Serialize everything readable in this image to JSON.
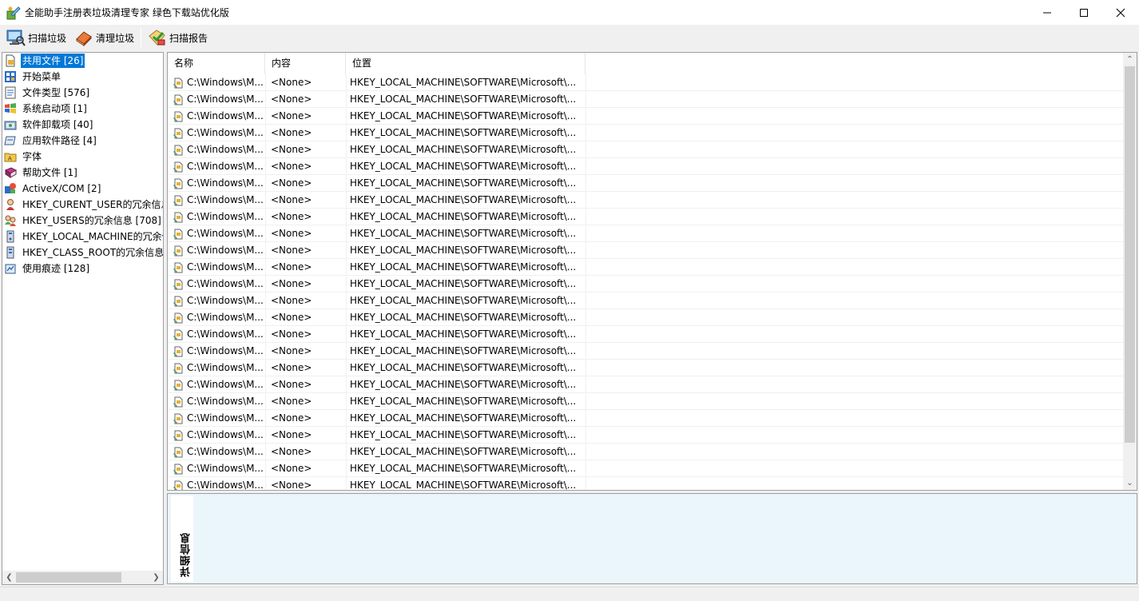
{
  "window": {
    "title": "全能助手注册表垃圾清理专家 绿色下载站优化版",
    "controls": [
      "minimize",
      "maximize",
      "close"
    ]
  },
  "toolbar": {
    "buttons": [
      {
        "label": "扫描垃圾",
        "icon": "scan-computer-icon"
      },
      {
        "label": "清理垃圾",
        "icon": "eraser-icon"
      },
      {
        "label": "扫描报告",
        "icon": "report-check-icon"
      }
    ]
  },
  "tree": {
    "items": [
      {
        "label": "共用文件 [26]",
        "icon": "shared-file-icon",
        "selected": true
      },
      {
        "label": "开始菜单",
        "icon": "start-menu-icon"
      },
      {
        "label": "文件类型 [576]",
        "icon": "file-type-icon"
      },
      {
        "label": "系统启动项 [1]",
        "icon": "windows-flag-icon"
      },
      {
        "label": "软件卸载项 [40]",
        "icon": "uninstall-icon"
      },
      {
        "label": "应用软件路径 [4]",
        "icon": "app-path-icon"
      },
      {
        "label": "字体",
        "icon": "font-folder-icon"
      },
      {
        "label": "帮助文件 [1]",
        "icon": "help-book-icon"
      },
      {
        "label": "ActiveX/COM [2]",
        "icon": "activex-icon"
      },
      {
        "label": "HKEY_CURENT_USER的冗余信息",
        "icon": "user-icon"
      },
      {
        "label": "HKEY_USERS的冗余信息 [708]",
        "icon": "users-icon"
      },
      {
        "label": "HKEY_LOCAL_MACHINE的冗余信息",
        "icon": "machine-icon"
      },
      {
        "label": "HKEY_CLASS_ROOT的冗余信息",
        "icon": "class-root-icon"
      },
      {
        "label": "使用痕迹 [128]",
        "icon": "trace-icon"
      }
    ]
  },
  "list": {
    "columns": [
      "名称",
      "内容",
      "位置"
    ],
    "rows": [
      [
        "C:\\Windows\\M...",
        "<None>",
        "HKEY_LOCAL_MACHINE\\SOFTWARE\\Microsoft\\..."
      ],
      [
        "C:\\Windows\\M...",
        "<None>",
        "HKEY_LOCAL_MACHINE\\SOFTWARE\\Microsoft\\..."
      ],
      [
        "C:\\Windows\\M...",
        "<None>",
        "HKEY_LOCAL_MACHINE\\SOFTWARE\\Microsoft\\..."
      ],
      [
        "C:\\Windows\\M...",
        "<None>",
        "HKEY_LOCAL_MACHINE\\SOFTWARE\\Microsoft\\..."
      ],
      [
        "C:\\Windows\\M...",
        "<None>",
        "HKEY_LOCAL_MACHINE\\SOFTWARE\\Microsoft\\..."
      ],
      [
        "C:\\Windows\\M...",
        "<None>",
        "HKEY_LOCAL_MACHINE\\SOFTWARE\\Microsoft\\..."
      ],
      [
        "C:\\Windows\\M...",
        "<None>",
        "HKEY_LOCAL_MACHINE\\SOFTWARE\\Microsoft\\..."
      ],
      [
        "C:\\Windows\\M...",
        "<None>",
        "HKEY_LOCAL_MACHINE\\SOFTWARE\\Microsoft\\..."
      ],
      [
        "C:\\Windows\\M...",
        "<None>",
        "HKEY_LOCAL_MACHINE\\SOFTWARE\\Microsoft\\..."
      ],
      [
        "C:\\Windows\\M...",
        "<None>",
        "HKEY_LOCAL_MACHINE\\SOFTWARE\\Microsoft\\..."
      ],
      [
        "C:\\Windows\\M...",
        "<None>",
        "HKEY_LOCAL_MACHINE\\SOFTWARE\\Microsoft\\..."
      ],
      [
        "C:\\Windows\\M...",
        "<None>",
        "HKEY_LOCAL_MACHINE\\SOFTWARE\\Microsoft\\..."
      ],
      [
        "C:\\Windows\\M...",
        "<None>",
        "HKEY_LOCAL_MACHINE\\SOFTWARE\\Microsoft\\..."
      ],
      [
        "C:\\Windows\\M...",
        "<None>",
        "HKEY_LOCAL_MACHINE\\SOFTWARE\\Microsoft\\..."
      ],
      [
        "C:\\Windows\\M...",
        "<None>",
        "HKEY_LOCAL_MACHINE\\SOFTWARE\\Microsoft\\..."
      ],
      [
        "C:\\Windows\\M...",
        "<None>",
        "HKEY_LOCAL_MACHINE\\SOFTWARE\\Microsoft\\..."
      ],
      [
        "C:\\Windows\\M...",
        "<None>",
        "HKEY_LOCAL_MACHINE\\SOFTWARE\\Microsoft\\..."
      ],
      [
        "C:\\Windows\\M...",
        "<None>",
        "HKEY_LOCAL_MACHINE\\SOFTWARE\\Microsoft\\..."
      ],
      [
        "C:\\Windows\\M...",
        "<None>",
        "HKEY_LOCAL_MACHINE\\SOFTWARE\\Microsoft\\..."
      ],
      [
        "C:\\Windows\\M...",
        "<None>",
        "HKEY_LOCAL_MACHINE\\SOFTWARE\\Microsoft\\..."
      ],
      [
        "C:\\Windows\\M...",
        "<None>",
        "HKEY_LOCAL_MACHINE\\SOFTWARE\\Microsoft\\..."
      ],
      [
        "C:\\Windows\\M...",
        "<None>",
        "HKEY_LOCAL_MACHINE\\SOFTWARE\\Microsoft\\..."
      ],
      [
        "C:\\Windows\\M...",
        "<None>",
        "HKEY_LOCAL_MACHINE\\SOFTWARE\\Microsoft\\..."
      ],
      [
        "C:\\Windows\\M...",
        "<None>",
        "HKEY_LOCAL_MACHINE\\SOFTWARE\\Microsoft\\..."
      ],
      [
        "C:\\Windows\\M...",
        "<None>",
        "HKEY_LOCAL_MACHINE\\SOFTWARE\\Microsoft\\..."
      ]
    ]
  },
  "detail": {
    "label": "详细信息"
  },
  "colors": {
    "selection": "#0078d7",
    "detail_bg": "#eaf5fc",
    "window_bg": "#f0f0f0"
  }
}
